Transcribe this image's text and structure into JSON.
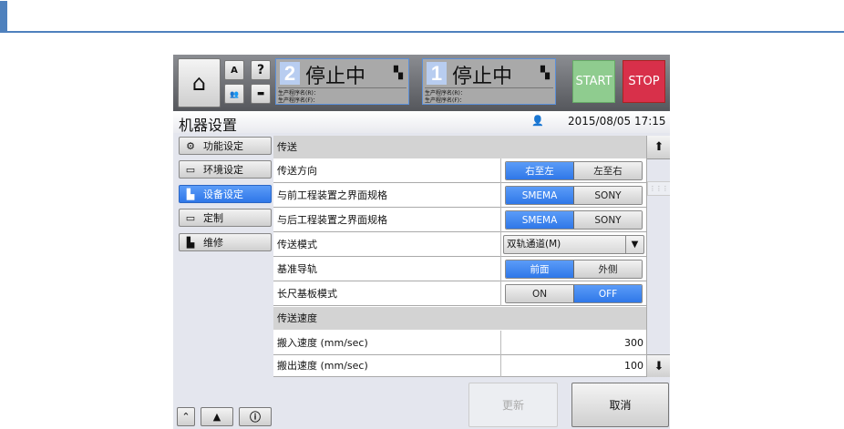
{
  "top": {
    "home_icon": "home-icon",
    "help": "?",
    "station2": {
      "num": "2",
      "state": "停止中",
      "prog_r": "生产程序名(R)：",
      "prog_f": "生产程序名(F)："
    },
    "station1": {
      "num": "1",
      "state": "停止中",
      "prog_r": "生产程序名(R)：",
      "prog_f": "生产程序名(F)："
    },
    "start": "START",
    "stop": "STOP"
  },
  "title": "机器设置",
  "datetime": "2015/08/05 17:15",
  "sidebar": [
    {
      "label": "功能设定",
      "icon": "gear-refresh-icon"
    },
    {
      "label": "环境设定",
      "icon": "monitor-settings-icon"
    },
    {
      "label": "设备设定",
      "icon": "machine-settings-icon",
      "active": true
    },
    {
      "label": "定制",
      "icon": "customize-icon"
    },
    {
      "label": "维修",
      "icon": "maintenance-icon"
    }
  ],
  "sections": [
    {
      "title": "传送",
      "rows": [
        {
          "label": "传送方向",
          "options": [
            "右至左",
            "左至右"
          ],
          "selected": 0
        },
        {
          "label": "与前工程装置之界面规格",
          "options": [
            "SMEMA",
            "SONY"
          ],
          "selected": 0
        },
        {
          "label": "与后工程装置之界面规格",
          "options": [
            "SMEMA",
            "SONY"
          ],
          "selected": 0
        },
        {
          "label": "传送模式",
          "select": "双轨通道(M)"
        },
        {
          "label": "基准导轨",
          "options": [
            "前面",
            "外侧"
          ],
          "selected": 0
        },
        {
          "label": "长尺基板模式",
          "options": [
            "ON",
            "OFF"
          ],
          "selected": 1
        }
      ]
    },
    {
      "title": "传送速度",
      "rows": [
        {
          "label": "搬入速度 (mm/sec)",
          "value": "300"
        },
        {
          "label": "搬出速度 (mm/sec)",
          "value": "100"
        }
      ]
    }
  ],
  "buttons": {
    "update": "更新",
    "cancel": "取消"
  },
  "colors": {
    "accent": "#4f81bd",
    "active": "#3a82f0",
    "start": "#8fcc8f",
    "stop": "#d8304a"
  }
}
